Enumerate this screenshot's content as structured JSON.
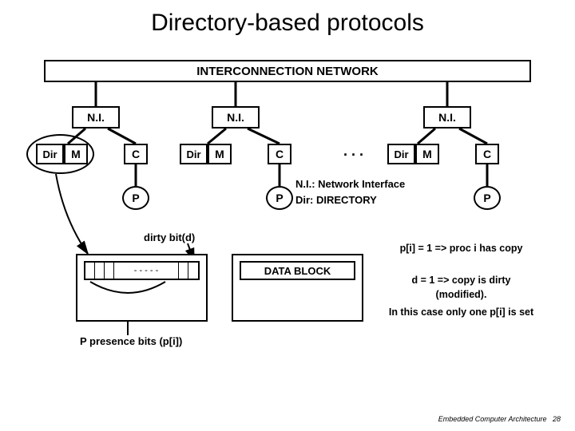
{
  "title": "Directory-based protocols",
  "interconnect": "INTERCONNECTION NETWORK",
  "ni": "N.I.",
  "dir": "Dir",
  "m": "M",
  "c": "C",
  "p": "P",
  "data_block": "DATA BLOCK",
  "dots": "- - - - -",
  "ni_expand": "N.I.: Network Interface",
  "dir_expand": "Dir: DIRECTORY",
  "dirty_bit": "dirty bit(d)",
  "presence": "P presence bits (p[i])",
  "notes": {
    "n1": "p[i] = 1 => proc i has copy",
    "n2": "d = 1 => copy is dirty (modified).",
    "n3": "In this case only one p[i] is set"
  },
  "footer_text": "Embedded Computer Architecture",
  "footer_page": "28"
}
